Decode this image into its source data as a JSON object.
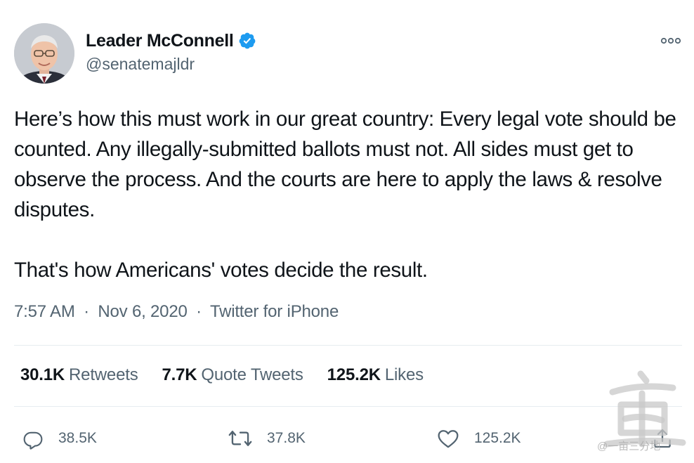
{
  "author": {
    "display_name": "Leader McConnell",
    "handle": "@senatemajldr",
    "verified": true,
    "avatar_icon": "avatar-portrait"
  },
  "tweet": {
    "paragraphs": [
      "Here’s how this must work in our great country: Every legal vote should be counted. Any illegally-submitted ballots must not. All sides must get to observe the process. And the courts are here to apply the laws & resolve disputes.",
      "That's how Americans' votes decide the result."
    ]
  },
  "meta": {
    "time": "7:57 AM",
    "date": "Nov 6, 2020",
    "source": "Twitter for iPhone",
    "separator": "·"
  },
  "stats": {
    "retweets": {
      "value": "30.1K",
      "label": "Retweets"
    },
    "quote_tweets": {
      "value": "7.7K",
      "label": "Quote Tweets"
    },
    "likes": {
      "value": "125.2K",
      "label": "Likes"
    }
  },
  "actions": {
    "reply_count": "38.5K",
    "retweet_count": "37.8K",
    "like_count": "125.2K"
  },
  "watermark": {
    "text": "@一亩三分地"
  },
  "colors": {
    "text_primary": "#0f1419",
    "text_secondary": "#536471",
    "verified_blue": "#1d9bf0",
    "divider": "#e6ecf0"
  }
}
